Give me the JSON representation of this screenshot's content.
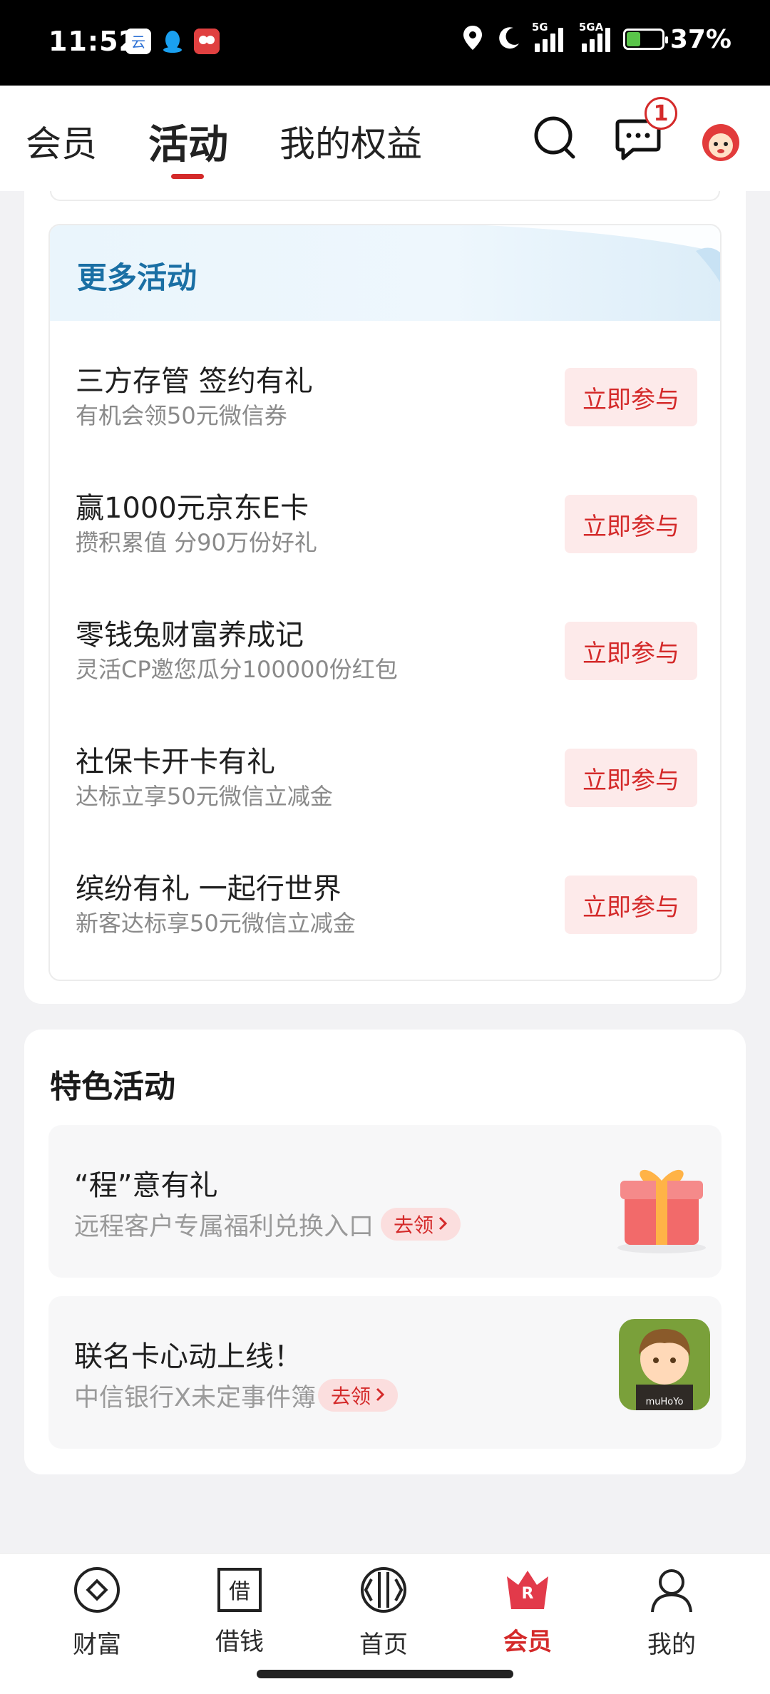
{
  "status_bar": {
    "time": "11:52",
    "network_1": "5G",
    "network_2": "5GA",
    "battery": "37%",
    "battery_level": 0.37
  },
  "header": {
    "tabs": [
      {
        "label": "会员"
      },
      {
        "label": "活动"
      },
      {
        "label": "我的权益"
      }
    ],
    "active_tab": "活动",
    "message_badge": "1"
  },
  "more_activities": {
    "title": "更多活动",
    "items": [
      {
        "title": "三方存管 签约有礼",
        "subtitle": "有机会领50元微信券",
        "button": "立即参与"
      },
      {
        "title": "赢1000元京东E卡",
        "subtitle": "攒积累值 分90万份好礼",
        "button": "立即参与"
      },
      {
        "title": "零钱兔财富养成记",
        "subtitle": "灵活CP邀您瓜分100000份红包",
        "button": "立即参与"
      },
      {
        "title": "社保卡开卡有礼",
        "subtitle": "达标立享50元微信立减金",
        "button": "立即参与"
      },
      {
        "title": "缤纷有礼 一起行世界",
        "subtitle": "新客达标享50元微信立减金",
        "button": "立即参与"
      }
    ]
  },
  "featured": {
    "title": "特色活动",
    "cards": [
      {
        "name": "“程”意有礼",
        "subtitle": "远程客户专属福利兑换入口",
        "action": "去领",
        "image": "gift-box-icon"
      },
      {
        "name": "联名卡心动上线！",
        "subtitle": "中信银行X未定事件簿",
        "action": "去领",
        "image": "character-avatar",
        "image_text": "muHoYo"
      }
    ]
  },
  "bottom_nav": {
    "items": [
      {
        "label": "财富",
        "icon": "wealth-icon"
      },
      {
        "label": "借钱",
        "icon": "loan-icon",
        "glyph": "借"
      },
      {
        "label": "首页",
        "icon": "home-icon"
      },
      {
        "label": "会员",
        "icon": "member-crown-icon",
        "glyph": "R"
      },
      {
        "label": "我的",
        "icon": "profile-icon"
      }
    ],
    "active": "会员"
  },
  "colors": {
    "accent": "#d42a2a",
    "more_title": "#1a6fa4",
    "button_bg": "#fdeaea"
  }
}
